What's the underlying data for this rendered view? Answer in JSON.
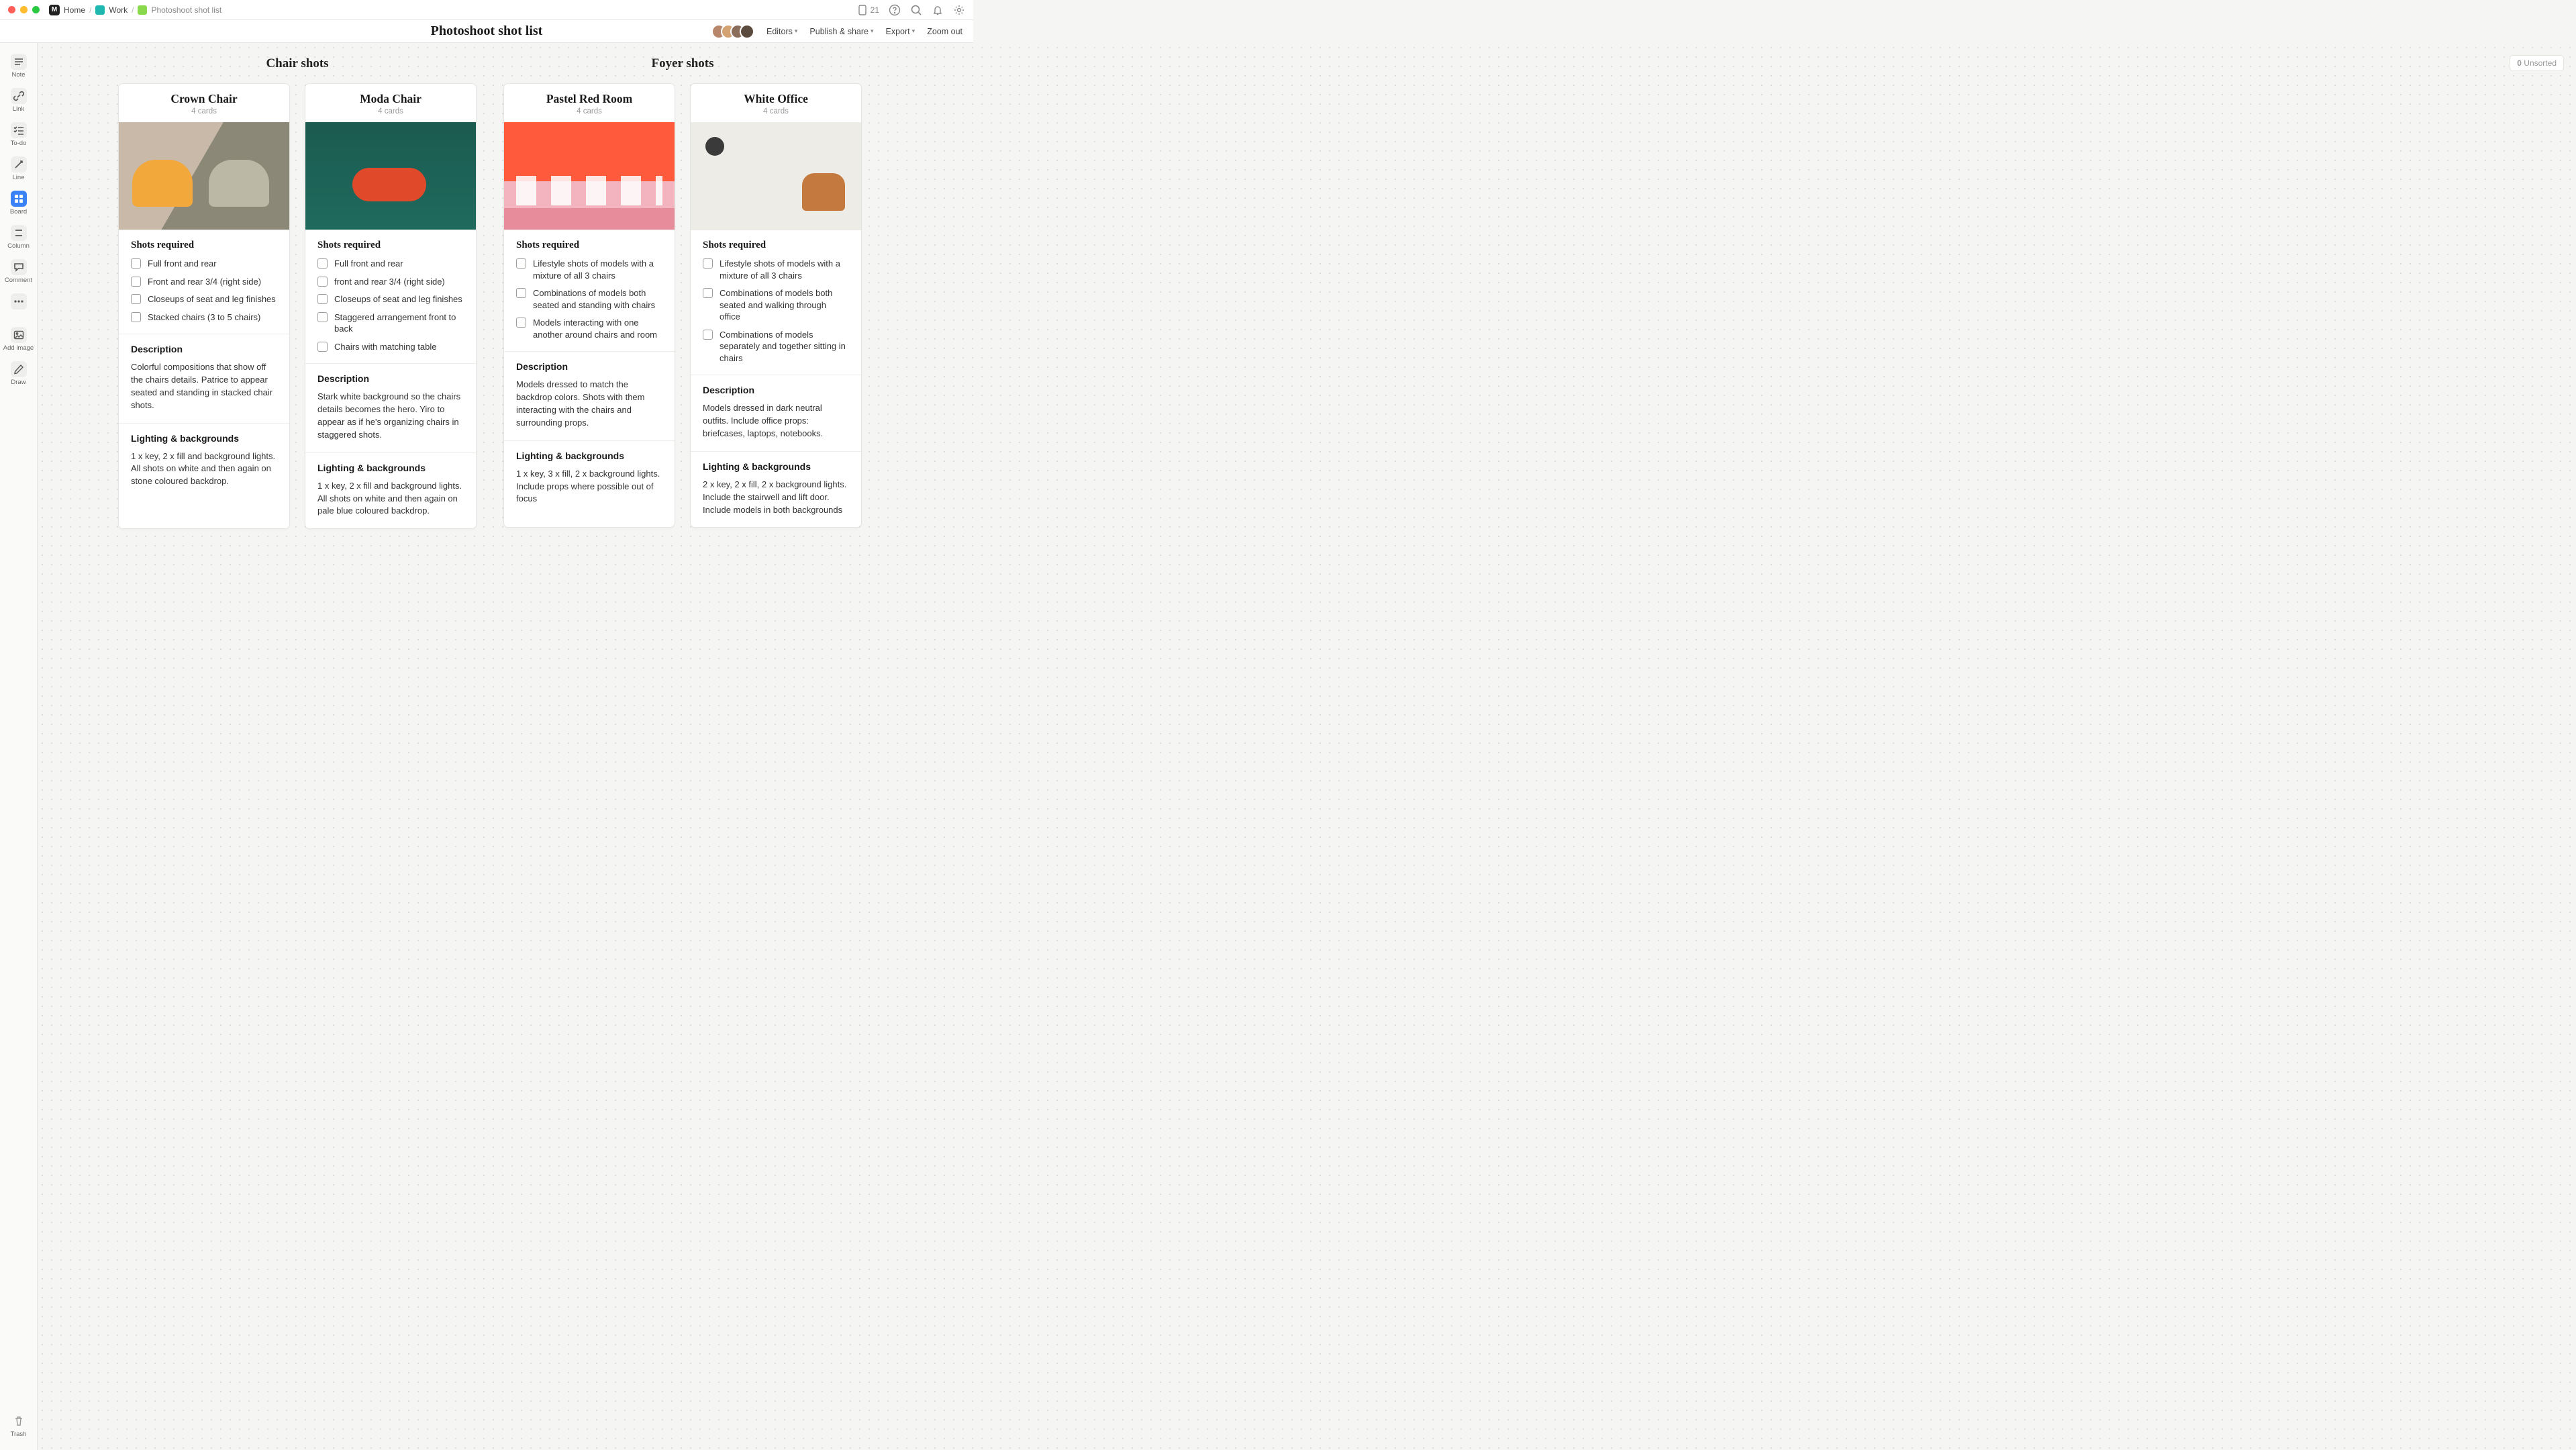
{
  "titlebar": {
    "home": "Home",
    "work": "Work",
    "doc": "Photoshoot shot list",
    "phone_count": "21"
  },
  "header": {
    "title": "Photoshoot shot list",
    "editors": "Editors",
    "publish": "Publish & share",
    "export": "Export",
    "zoom": "Zoom out"
  },
  "sidebar": {
    "note": "Note",
    "link": "Link",
    "todo": "To-do",
    "line": "Line",
    "board": "Board",
    "column": "Column",
    "comment": "Comment",
    "add_image": "Add image",
    "draw": "Draw",
    "trash": "Trash"
  },
  "unsorted": {
    "count": "0",
    "label": "Unsorted"
  },
  "sections": [
    {
      "title": "Chair shots"
    },
    {
      "title": "Foyer shots"
    }
  ],
  "labels": {
    "shots": "Shots required",
    "desc": "Description",
    "light": "Lighting & backgrounds"
  },
  "cards": [
    {
      "title": "Crown Chair",
      "sub": "4 cards",
      "img": "img-crown",
      "todos": [
        "Full front and rear",
        "Front and rear 3/4 (right side)",
        "Closeups of seat and leg finishes",
        "Stacked chairs (3 to 5 chairs)"
      ],
      "desc": "Colorful compositions that show off the chairs details. Patrice to appear seated and standing in stacked chair shots.",
      "light": "1 x key, 2 x fill and background lights. All shots on white and then again on stone coloured backdrop."
    },
    {
      "title": "Moda Chair",
      "sub": "4 cards",
      "img": "img-moda",
      "todos": [
        "Full front and rear",
        "front and rear 3/4 (right side)",
        "Closeups of seat and leg finishes",
        "Staggered arrangement front to back",
        "Chairs with matching table"
      ],
      "desc": "Stark white background so the chairs details becomes the hero. Yiro to appear as if he's organizing chairs in staggered shots.",
      "light": "1 x key, 2 x fill and background lights. All shots on white and then again on pale blue coloured backdrop."
    },
    {
      "title": "Pastel Red Room",
      "sub": "4 cards",
      "img": "img-pastel",
      "todos": [
        "Lifestyle shots of models with a mixture of all 3 chairs",
        "Combinations of models both seated and standing with chairs",
        "Models interacting with one another around chairs and room"
      ],
      "desc": "Models dressed to match the backdrop colors. Shots with them interacting with the chairs and surrounding props.",
      "light": "1 x key, 3 x fill, 2 x background lights. Include props where possible out of focus"
    },
    {
      "title": "White Office",
      "sub": "4 cards",
      "img": "img-white",
      "todos": [
        "Lifestyle shots of models with a mixture of all 3 chairs",
        "Combinations of models both seated and walking through office",
        "Combinations of models separately and together sitting in chairs"
      ],
      "desc": "Models dressed in dark neutral outfits. Include office props: briefcases, laptops, notebooks.",
      "light": "2 x key, 2 x fill, 2 x background lights. Include the stairwell and lift door. Include models in both backgrounds"
    }
  ]
}
